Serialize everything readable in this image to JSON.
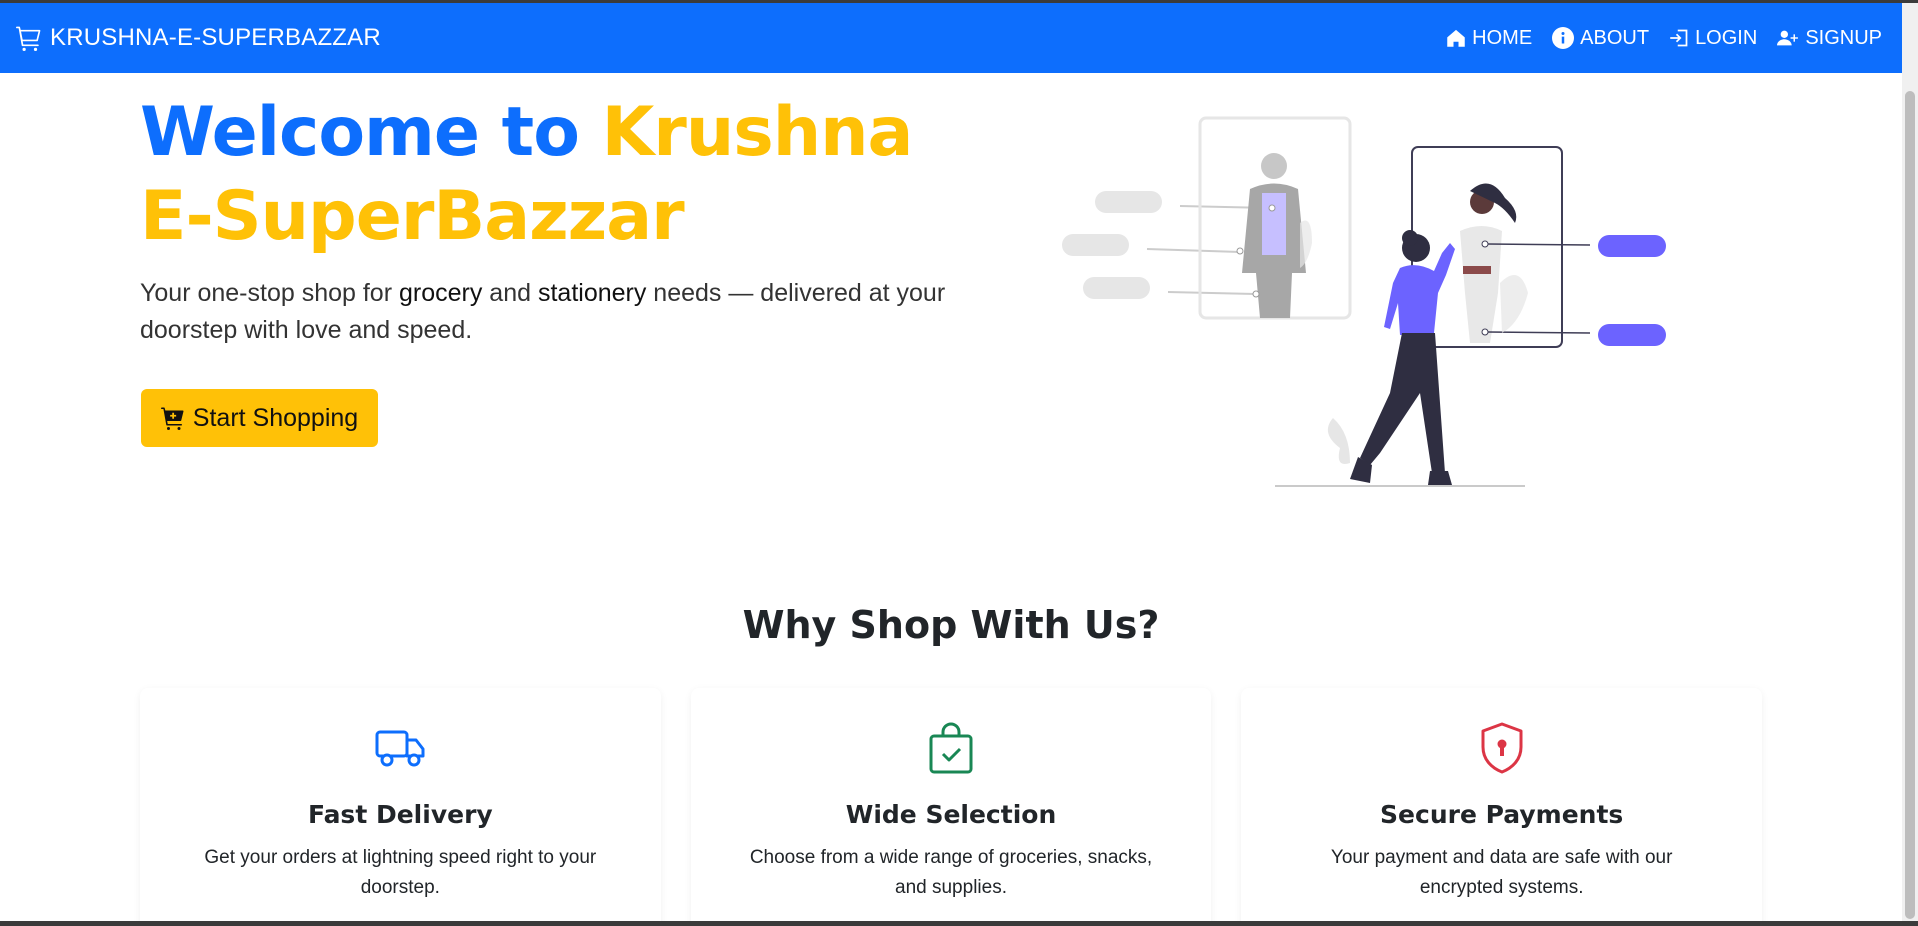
{
  "navbar": {
    "brand": "KRUSHNA-E-SUPERBAZZAR",
    "brand_icon": "cart-icon",
    "items": [
      {
        "label": "HOME",
        "icon": "home-icon"
      },
      {
        "label": "ABOUT",
        "icon": "info-icon"
      },
      {
        "label": "LOGIN",
        "icon": "login-icon"
      },
      {
        "label": "SIGNUP",
        "icon": "person-plus-icon"
      }
    ]
  },
  "hero": {
    "title_part1": "Welcome to ",
    "title_part2": "Krushna E-SuperBazzar",
    "subtitle_pre": "Your one-stop shop for ",
    "subtitle_b1": "grocery",
    "subtitle_mid": " and ",
    "subtitle_b2": "stationery",
    "subtitle_post": " needs — delivered at your doorstep with love and speed.",
    "button_label": "Start Shopping",
    "button_icon": "cart-plus-icon"
  },
  "features": {
    "title": "Why Shop With Us?",
    "cards": [
      {
        "icon": "truck-icon",
        "title": "Fast Delivery",
        "text": "Get your orders at lightning speed right to your doorstep."
      },
      {
        "icon": "bag-check-icon",
        "title": "Wide Selection",
        "text": "Choose from a wide range of groceries, snacks, and supplies."
      },
      {
        "icon": "shield-lock-icon",
        "title": "Secure Payments",
        "text": "Your payment and data are safe with our encrypted systems."
      }
    ]
  },
  "colors": {
    "primary": "#0d6efd",
    "accent": "#ffc107",
    "success": "#198754",
    "danger": "#dc3545",
    "illustration": "#6c63ff"
  }
}
